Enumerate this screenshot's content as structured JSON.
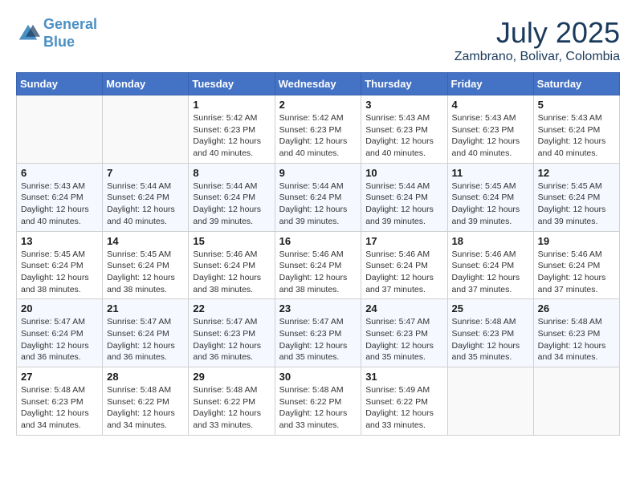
{
  "header": {
    "logo_line1": "General",
    "logo_line2": "Blue",
    "month": "July 2025",
    "location": "Zambrano, Bolivar, Colombia"
  },
  "weekdays": [
    "Sunday",
    "Monday",
    "Tuesday",
    "Wednesday",
    "Thursday",
    "Friday",
    "Saturday"
  ],
  "weeks": [
    [
      {
        "day": "",
        "sunrise": "",
        "sunset": "",
        "daylight": ""
      },
      {
        "day": "",
        "sunrise": "",
        "sunset": "",
        "daylight": ""
      },
      {
        "day": "1",
        "sunrise": "Sunrise: 5:42 AM",
        "sunset": "Sunset: 6:23 PM",
        "daylight": "Daylight: 12 hours and 40 minutes."
      },
      {
        "day": "2",
        "sunrise": "Sunrise: 5:42 AM",
        "sunset": "Sunset: 6:23 PM",
        "daylight": "Daylight: 12 hours and 40 minutes."
      },
      {
        "day": "3",
        "sunrise": "Sunrise: 5:43 AM",
        "sunset": "Sunset: 6:23 PM",
        "daylight": "Daylight: 12 hours and 40 minutes."
      },
      {
        "day": "4",
        "sunrise": "Sunrise: 5:43 AM",
        "sunset": "Sunset: 6:23 PM",
        "daylight": "Daylight: 12 hours and 40 minutes."
      },
      {
        "day": "5",
        "sunrise": "Sunrise: 5:43 AM",
        "sunset": "Sunset: 6:24 PM",
        "daylight": "Daylight: 12 hours and 40 minutes."
      }
    ],
    [
      {
        "day": "6",
        "sunrise": "Sunrise: 5:43 AM",
        "sunset": "Sunset: 6:24 PM",
        "daylight": "Daylight: 12 hours and 40 minutes."
      },
      {
        "day": "7",
        "sunrise": "Sunrise: 5:44 AM",
        "sunset": "Sunset: 6:24 PM",
        "daylight": "Daylight: 12 hours and 40 minutes."
      },
      {
        "day": "8",
        "sunrise": "Sunrise: 5:44 AM",
        "sunset": "Sunset: 6:24 PM",
        "daylight": "Daylight: 12 hours and 39 minutes."
      },
      {
        "day": "9",
        "sunrise": "Sunrise: 5:44 AM",
        "sunset": "Sunset: 6:24 PM",
        "daylight": "Daylight: 12 hours and 39 minutes."
      },
      {
        "day": "10",
        "sunrise": "Sunrise: 5:44 AM",
        "sunset": "Sunset: 6:24 PM",
        "daylight": "Daylight: 12 hours and 39 minutes."
      },
      {
        "day": "11",
        "sunrise": "Sunrise: 5:45 AM",
        "sunset": "Sunset: 6:24 PM",
        "daylight": "Daylight: 12 hours and 39 minutes."
      },
      {
        "day": "12",
        "sunrise": "Sunrise: 5:45 AM",
        "sunset": "Sunset: 6:24 PM",
        "daylight": "Daylight: 12 hours and 39 minutes."
      }
    ],
    [
      {
        "day": "13",
        "sunrise": "Sunrise: 5:45 AM",
        "sunset": "Sunset: 6:24 PM",
        "daylight": "Daylight: 12 hours and 38 minutes."
      },
      {
        "day": "14",
        "sunrise": "Sunrise: 5:45 AM",
        "sunset": "Sunset: 6:24 PM",
        "daylight": "Daylight: 12 hours and 38 minutes."
      },
      {
        "day": "15",
        "sunrise": "Sunrise: 5:46 AM",
        "sunset": "Sunset: 6:24 PM",
        "daylight": "Daylight: 12 hours and 38 minutes."
      },
      {
        "day": "16",
        "sunrise": "Sunrise: 5:46 AM",
        "sunset": "Sunset: 6:24 PM",
        "daylight": "Daylight: 12 hours and 38 minutes."
      },
      {
        "day": "17",
        "sunrise": "Sunrise: 5:46 AM",
        "sunset": "Sunset: 6:24 PM",
        "daylight": "Daylight: 12 hours and 37 minutes."
      },
      {
        "day": "18",
        "sunrise": "Sunrise: 5:46 AM",
        "sunset": "Sunset: 6:24 PM",
        "daylight": "Daylight: 12 hours and 37 minutes."
      },
      {
        "day": "19",
        "sunrise": "Sunrise: 5:46 AM",
        "sunset": "Sunset: 6:24 PM",
        "daylight": "Daylight: 12 hours and 37 minutes."
      }
    ],
    [
      {
        "day": "20",
        "sunrise": "Sunrise: 5:47 AM",
        "sunset": "Sunset: 6:24 PM",
        "daylight": "Daylight: 12 hours and 36 minutes."
      },
      {
        "day": "21",
        "sunrise": "Sunrise: 5:47 AM",
        "sunset": "Sunset: 6:24 PM",
        "daylight": "Daylight: 12 hours and 36 minutes."
      },
      {
        "day": "22",
        "sunrise": "Sunrise: 5:47 AM",
        "sunset": "Sunset: 6:23 PM",
        "daylight": "Daylight: 12 hours and 36 minutes."
      },
      {
        "day": "23",
        "sunrise": "Sunrise: 5:47 AM",
        "sunset": "Sunset: 6:23 PM",
        "daylight": "Daylight: 12 hours and 35 minutes."
      },
      {
        "day": "24",
        "sunrise": "Sunrise: 5:47 AM",
        "sunset": "Sunset: 6:23 PM",
        "daylight": "Daylight: 12 hours and 35 minutes."
      },
      {
        "day": "25",
        "sunrise": "Sunrise: 5:48 AM",
        "sunset": "Sunset: 6:23 PM",
        "daylight": "Daylight: 12 hours and 35 minutes."
      },
      {
        "day": "26",
        "sunrise": "Sunrise: 5:48 AM",
        "sunset": "Sunset: 6:23 PM",
        "daylight": "Daylight: 12 hours and 34 minutes."
      }
    ],
    [
      {
        "day": "27",
        "sunrise": "Sunrise: 5:48 AM",
        "sunset": "Sunset: 6:23 PM",
        "daylight": "Daylight: 12 hours and 34 minutes."
      },
      {
        "day": "28",
        "sunrise": "Sunrise: 5:48 AM",
        "sunset": "Sunset: 6:22 PM",
        "daylight": "Daylight: 12 hours and 34 minutes."
      },
      {
        "day": "29",
        "sunrise": "Sunrise: 5:48 AM",
        "sunset": "Sunset: 6:22 PM",
        "daylight": "Daylight: 12 hours and 33 minutes."
      },
      {
        "day": "30",
        "sunrise": "Sunrise: 5:48 AM",
        "sunset": "Sunset: 6:22 PM",
        "daylight": "Daylight: 12 hours and 33 minutes."
      },
      {
        "day": "31",
        "sunrise": "Sunrise: 5:49 AM",
        "sunset": "Sunset: 6:22 PM",
        "daylight": "Daylight: 12 hours and 33 minutes."
      },
      {
        "day": "",
        "sunrise": "",
        "sunset": "",
        "daylight": ""
      },
      {
        "day": "",
        "sunrise": "",
        "sunset": "",
        "daylight": ""
      }
    ]
  ]
}
